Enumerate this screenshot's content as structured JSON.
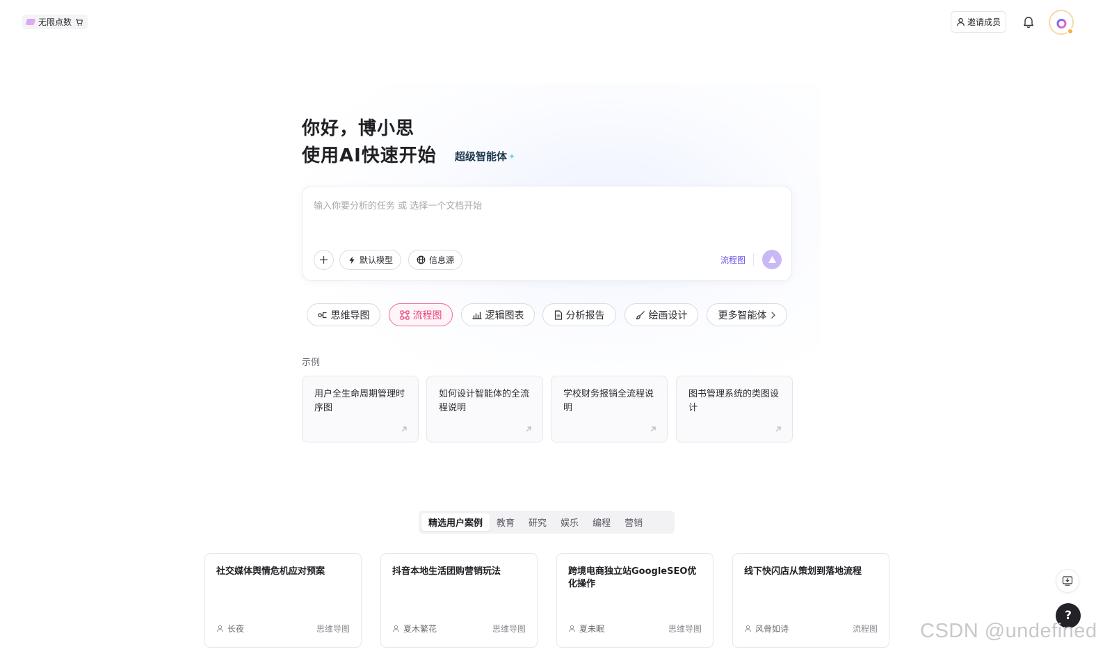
{
  "topbar": {
    "points_label": "无限点数",
    "invite_label": "邀请成员"
  },
  "hero": {
    "greeting": "你好，博小思",
    "subtitle": "使用AI快速开始",
    "agent_badge": "超级智能体"
  },
  "composer": {
    "placeholder": "输入你要分析的任务 或 选择一个文档开始",
    "model_label": "默认模型",
    "source_label": "信息源",
    "mode_label": "流程图"
  },
  "tools": [
    {
      "label": "思维导图"
    },
    {
      "label": "流程图",
      "active": true
    },
    {
      "label": "逻辑图表"
    },
    {
      "label": "分析报告"
    },
    {
      "label": "绘画设计"
    },
    {
      "label": "更多智能体"
    }
  ],
  "examples": {
    "label": "示例",
    "items": [
      {
        "text": "用户全生命周期管理时序图"
      },
      {
        "text": "如何设计智能体的全流程说明"
      },
      {
        "text": "学校财务报销全流程说明"
      },
      {
        "text": "图书管理系统的类图设计"
      }
    ]
  },
  "categories": [
    {
      "label": "精选用户案例",
      "active": true
    },
    {
      "label": "教育"
    },
    {
      "label": "研究"
    },
    {
      "label": "娱乐"
    },
    {
      "label": "编程"
    },
    {
      "label": "营销"
    }
  ],
  "cases": [
    {
      "title": "社交媒体舆情危机应对预案",
      "author": "长夜",
      "type": "思维导图"
    },
    {
      "title": "抖音本地生活团购营销玩法",
      "author": "夏木繁花",
      "type": "思维导图"
    },
    {
      "title": "跨境电商独立站GoogleSEO优化操作",
      "author": "夏未眠",
      "type": "思维导图"
    },
    {
      "title": "线下快闪店从策划到落地流程",
      "author": "风骨如诗",
      "type": "流程图"
    }
  ],
  "help_label": "?",
  "watermark": "CSDN @undefined",
  "colors": {
    "accent_purple": "#6e52e8",
    "active_pink": "#e8467d",
    "send_button": "#c9b8f5"
  }
}
